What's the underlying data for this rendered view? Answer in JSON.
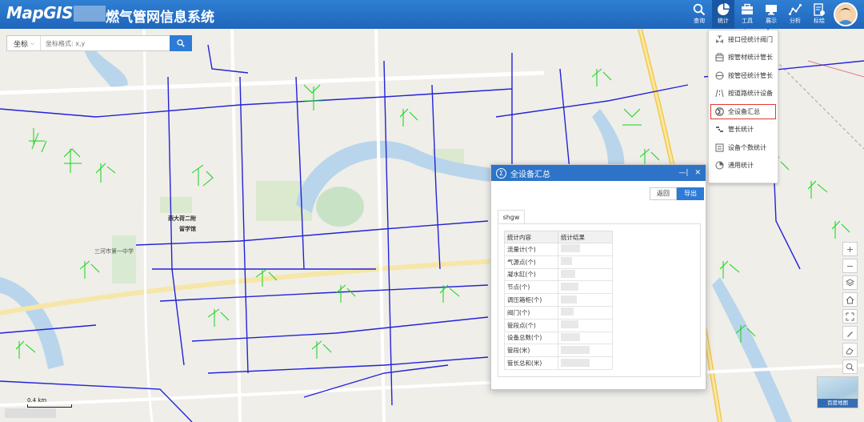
{
  "header": {
    "logo": "MapGIS",
    "title": "燃气管网信息系统",
    "tools": [
      {
        "label": "查询",
        "icon": "search-icon"
      },
      {
        "label": "统计",
        "icon": "pie-chart-icon"
      },
      {
        "label": "工具",
        "icon": "toolbox-icon"
      },
      {
        "label": "展示",
        "icon": "monitor-icon"
      },
      {
        "label": "分析",
        "icon": "line-analysis-icon"
      },
      {
        "label": "标绘",
        "icon": "plot-document-icon"
      }
    ],
    "active_tool": "统计"
  },
  "search": {
    "coord_label": "坐标",
    "placeholder": "坐标格式: x,y"
  },
  "stats_menu": {
    "items": [
      {
        "label": "接口径统计阀门",
        "icon": "valve-icon"
      },
      {
        "label": "按管材统计管长",
        "icon": "material-icon"
      },
      {
        "label": "按管径统计管长",
        "icon": "diameter-icon"
      },
      {
        "label": "按道路统计设备",
        "icon": "road-icon"
      },
      {
        "label": "全设备汇总",
        "icon": "sum-icon"
      },
      {
        "label": "管长统计",
        "icon": "pipe-length-icon"
      },
      {
        "label": "设备个数统计",
        "icon": "device-count-icon"
      },
      {
        "label": "通用统计",
        "icon": "general-stats-icon"
      }
    ],
    "selected": "全设备汇总"
  },
  "dialog": {
    "title": "全设备汇总",
    "back_label": "返回",
    "export_label": "导出",
    "tab_label": "shgw",
    "columns": [
      "统计内容",
      "统计结果"
    ],
    "rows": [
      "流量计(个)",
      "气源点(个)",
      "凝水缸(个)",
      "节点(个)",
      "调压箱柜(个)",
      "阀门(个)",
      "管段点(个)",
      "设备总数(个)",
      "管段(米)",
      "管长总和(米)"
    ]
  },
  "map": {
    "scale": "0.4 km",
    "basemap_label": "百度地图",
    "place_labels": [
      "三河市第一中学",
      "燕大荷二附",
      "留学馆"
    ]
  }
}
